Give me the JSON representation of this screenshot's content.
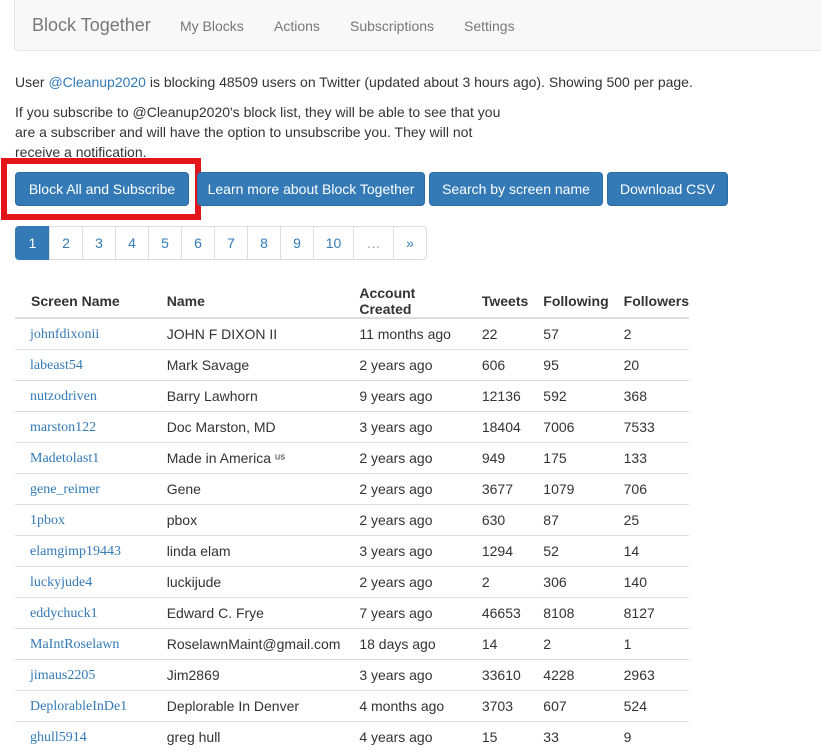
{
  "navbar": {
    "brand": "Block Together",
    "items": [
      "My Blocks",
      "Actions",
      "Subscriptions",
      "Settings"
    ]
  },
  "info": {
    "prefix": "User ",
    "user_link": "@Cleanup2020",
    "suffix": " is blocking 48509 users on Twitter (updated about 3 hours ago). Showing 500 per page.",
    "subscribe_note_line1": "If you subscribe to @Cleanup2020's block list, they will be able to see that you",
    "subscribe_note_line2": "are a subscriber and will have the option to unsubscribe you. They will not",
    "subscribe_note_line3": "receive a notification."
  },
  "buttons": {
    "block_all": "Block All and Subscribe",
    "learn_more": "Learn more about Block Together",
    "search": "Search by screen name",
    "download": "Download CSV"
  },
  "pagination": {
    "pages": [
      "1",
      "2",
      "3",
      "4",
      "5",
      "6",
      "7",
      "8",
      "9",
      "10"
    ],
    "active": "1",
    "ellipsis": "…",
    "next": "»"
  },
  "table": {
    "headers": [
      "Screen Name",
      "Name",
      "Account Created",
      "Tweets",
      "Following",
      "Followers"
    ],
    "rows": [
      [
        "johnfdixonii",
        "JOHN F DIXON II",
        "11 months ago",
        "22",
        "57",
        "2"
      ],
      [
        "labeast54",
        "Mark Savage",
        "2 years ago",
        "606",
        "95",
        "20"
      ],
      [
        "nutzodriven",
        "Barry Lawhorn",
        "9 years ago",
        "12136",
        "592",
        "368"
      ],
      [
        "marston122",
        "Doc Marston, MD",
        "3 years ago",
        "18404",
        "7006",
        "7533"
      ],
      [
        "Madetolast1",
        "Made in America ᵘˢ",
        "2 years ago",
        "949",
        "175",
        "133"
      ],
      [
        "gene_reimer",
        "Gene",
        "2 years ago",
        "3677",
        "1079",
        "706"
      ],
      [
        "1pbox",
        "pbox",
        "2 years ago",
        "630",
        "87",
        "25"
      ],
      [
        "elamgimp19443",
        "linda elam",
        "3 years ago",
        "1294",
        "52",
        "14"
      ],
      [
        "luckyjude4",
        "luckijude",
        "2 years ago",
        "2",
        "306",
        "140"
      ],
      [
        "eddychuck1",
        "Edward C. Frye",
        "7 years ago",
        "46653",
        "8108",
        "8127"
      ],
      [
        "MaIntRoselawn",
        "RoselawnMaint@gmail.com",
        "18 days ago",
        "14",
        "2",
        "1"
      ],
      [
        "jimaus2205",
        "Jim2869",
        "3 years ago",
        "33610",
        "4228",
        "2963"
      ],
      [
        "DeplorableInDe1",
        "Deplorable In Denver",
        "4 months ago",
        "3703",
        "607",
        "524"
      ],
      [
        "ghull5914",
        "greg hull",
        "4 years ago",
        "15",
        "33",
        "9"
      ]
    ]
  }
}
